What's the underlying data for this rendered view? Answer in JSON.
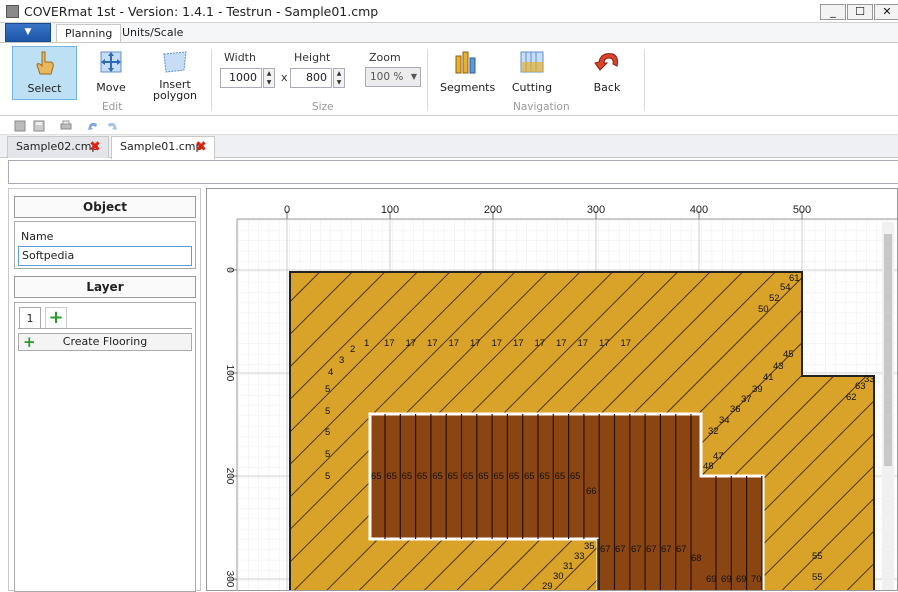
{
  "window": {
    "title": "COVERmat 1st - Version: 1.4.1 - Testrun - Sample01.cmp",
    "minimize": "_",
    "maximize": "☐",
    "close": "✕"
  },
  "ribbon_tabs": [
    {
      "label": "Planning"
    },
    {
      "label": "Units/Scale"
    }
  ],
  "app_menu_arrow": "▼",
  "ribbon": {
    "select_label": "Select",
    "move_label": "Move",
    "insert_polygon_label": "Insert\npolygon",
    "edit_group": "Edit",
    "width_label": "Width",
    "width_value": "1000",
    "height_label": "Height",
    "height_value": "800",
    "times": "x",
    "size_group": "Size",
    "zoom_label": "Zoom",
    "zoom_value": "100 %",
    "segments_label": "Segments",
    "cutting_label": "Cutting",
    "navigation_group": "Navigation",
    "back_label": "Back"
  },
  "doc_tabs": [
    {
      "label": "Sample02.cmp"
    },
    {
      "label": "Sample01.cmp"
    }
  ],
  "panel": {
    "object_header": "Object",
    "name_label": "Name",
    "name_value": "Softpedia",
    "layer_header": "Layer",
    "layer_tab": "1",
    "add_icon": "+",
    "create_flooring_label": "Create Flooring"
  },
  "ruler": {
    "x_ticks": [
      "0",
      "100",
      "200",
      "300",
      "400",
      "500"
    ],
    "y_ticks": [
      "0",
      "100",
      "200",
      "300"
    ]
  },
  "segment_labels": {
    "row17": [
      "1",
      "17",
      "17",
      "17",
      "17",
      "17",
      "17",
      "17",
      "17",
      "17",
      "17",
      "17",
      "17"
    ],
    "left5": [
      "2",
      "3",
      "4",
      "5",
      "5",
      "5",
      "5",
      "5"
    ],
    "right_diag": [
      "61",
      "54",
      "52",
      "50",
      "45",
      "43",
      "41",
      "39",
      "37",
      "36",
      "34",
      "32",
      "47",
      "48",
      "63",
      "62",
      "33"
    ],
    "inner65": [
      "65",
      "65",
      "65",
      "65",
      "65",
      "65",
      "65",
      "65",
      "65",
      "65",
      "65",
      "65",
      "65",
      "65"
    ],
    "inner_misc": [
      "66",
      "35",
      "33",
      "31",
      "30",
      "29",
      "67",
      "67",
      "67",
      "67",
      "67",
      "67",
      "68",
      "69",
      "69",
      "69",
      "70",
      "55",
      "55"
    ]
  },
  "colors": {
    "floor_gold": "#d9a228",
    "floor_brown": "#8a4512",
    "select_bg": "#bde0f5",
    "close_red": "#d21"
  }
}
